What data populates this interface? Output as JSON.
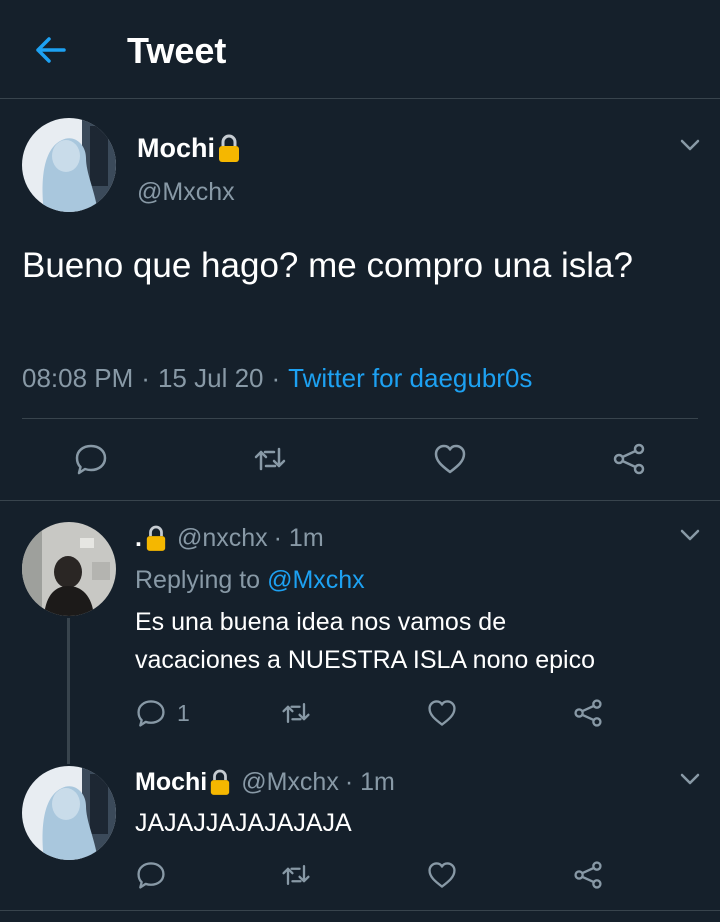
{
  "header": {
    "title": "Tweet"
  },
  "main_tweet": {
    "author_name": "Mochi",
    "handle": "@Mxchx",
    "text": "Bueno que hago? me compro una isla?",
    "time": "08:08 PM",
    "date": "15 Jul 20",
    "separator": "·",
    "source": "Twitter for daegubr0s"
  },
  "reply1": {
    "author_name": ".",
    "handle": "@nxchx",
    "time": "· 1m",
    "replying_to_label": "Replying to",
    "replying_to_handle": "@Mxchx",
    "text_line1": "Es una buena idea nos vamos de",
    "text_line2": "vacaciones a NUESTRA ISLA nono epico",
    "reply_count": "1"
  },
  "reply2": {
    "author_name": "Mochi",
    "handle": "@Mxchx",
    "time": "· 1m",
    "text": "JAJAJJAJAJAJAJA"
  },
  "icons": {
    "back": "arrow-left-icon",
    "chevron": "chevron-down-icon",
    "reply": "reply-icon",
    "retweet": "retweet-icon",
    "like": "heart-icon",
    "share": "share-icon",
    "lock": "lock-icon"
  },
  "colors": {
    "background": "#15202b",
    "divider": "#38444d",
    "muted": "#8899a6",
    "accent": "#1da1f2",
    "lock": "#f5b700"
  }
}
